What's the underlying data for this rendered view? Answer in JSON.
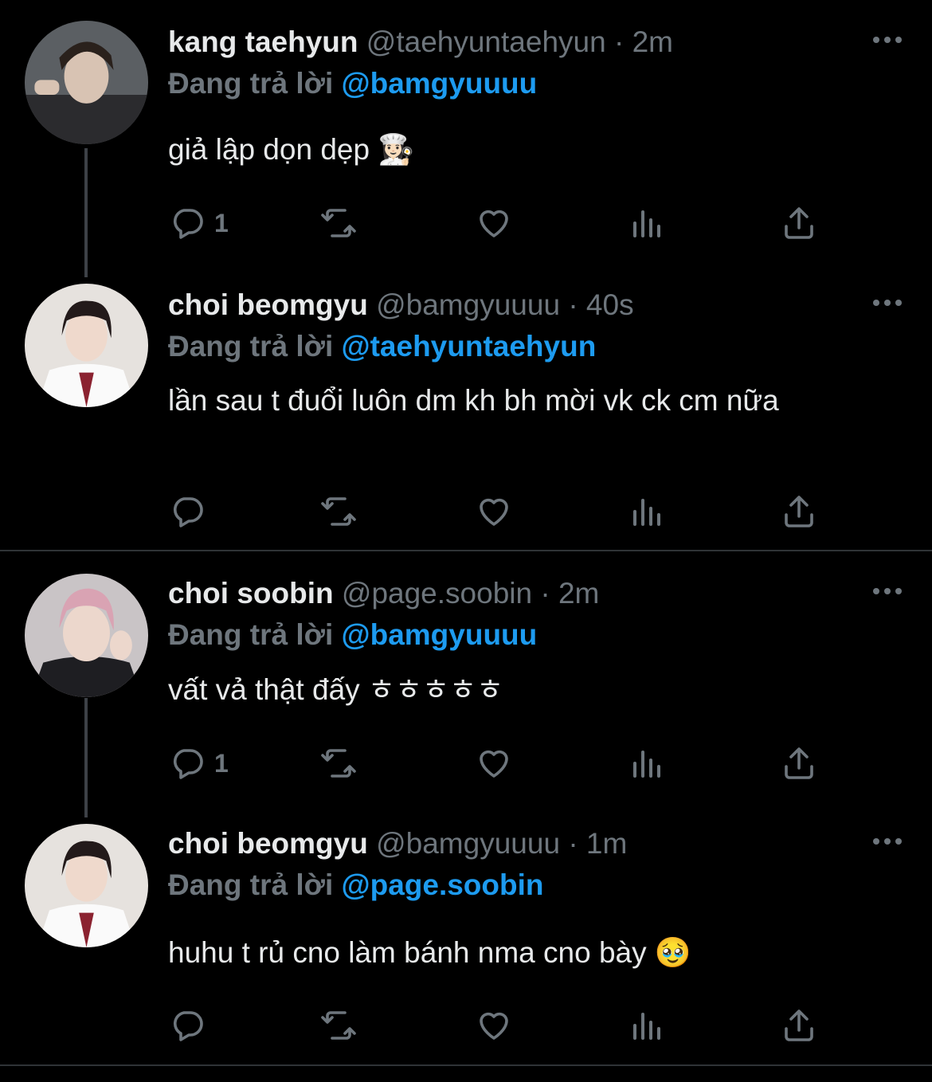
{
  "colors": {
    "background": "#000000",
    "text": "#e7e9ea",
    "muted": "#6e767d",
    "link": "#1d9bf0"
  },
  "tweets": [
    {
      "name": "kang taehyun",
      "handle": "@taehyuntaehyun",
      "separator": "·",
      "time": "2m",
      "replying_label": "Đang trả lời",
      "replying_to": "@bamgyuuuu",
      "text": "giả lập dọn dẹp 👩🏻‍🍳",
      "reply_count": "1"
    },
    {
      "name": "choi beomgyu",
      "handle": "@bamgyuuuu",
      "separator": "·",
      "time": "40s",
      "replying_label": "Đang trả lời",
      "replying_to": "@taehyuntaehyun",
      "text": "lần sau t đuổi luôn dm kh bh mời vk ck cm nữa",
      "reply_count": ""
    },
    {
      "name": "choi soobin",
      "handle": "@page.soobin",
      "separator": "·",
      "time": "2m",
      "replying_label": "Đang trả lời",
      "replying_to": "@bamgyuuuu",
      "text": "vất vả thật đấy ㅎㅎㅎㅎㅎ",
      "reply_count": "1"
    },
    {
      "name": "choi beomgyu",
      "handle": "@bamgyuuuu",
      "separator": "·",
      "time": "1m",
      "replying_label": "Đang trả lời",
      "replying_to": "@page.soobin",
      "text": "huhu t rủ cno làm bánh nma cno bày 🥹",
      "reply_count": ""
    }
  ],
  "icons": [
    "reply-icon",
    "retweet-icon",
    "like-icon",
    "analytics-icon",
    "share-icon",
    "more-icon"
  ]
}
